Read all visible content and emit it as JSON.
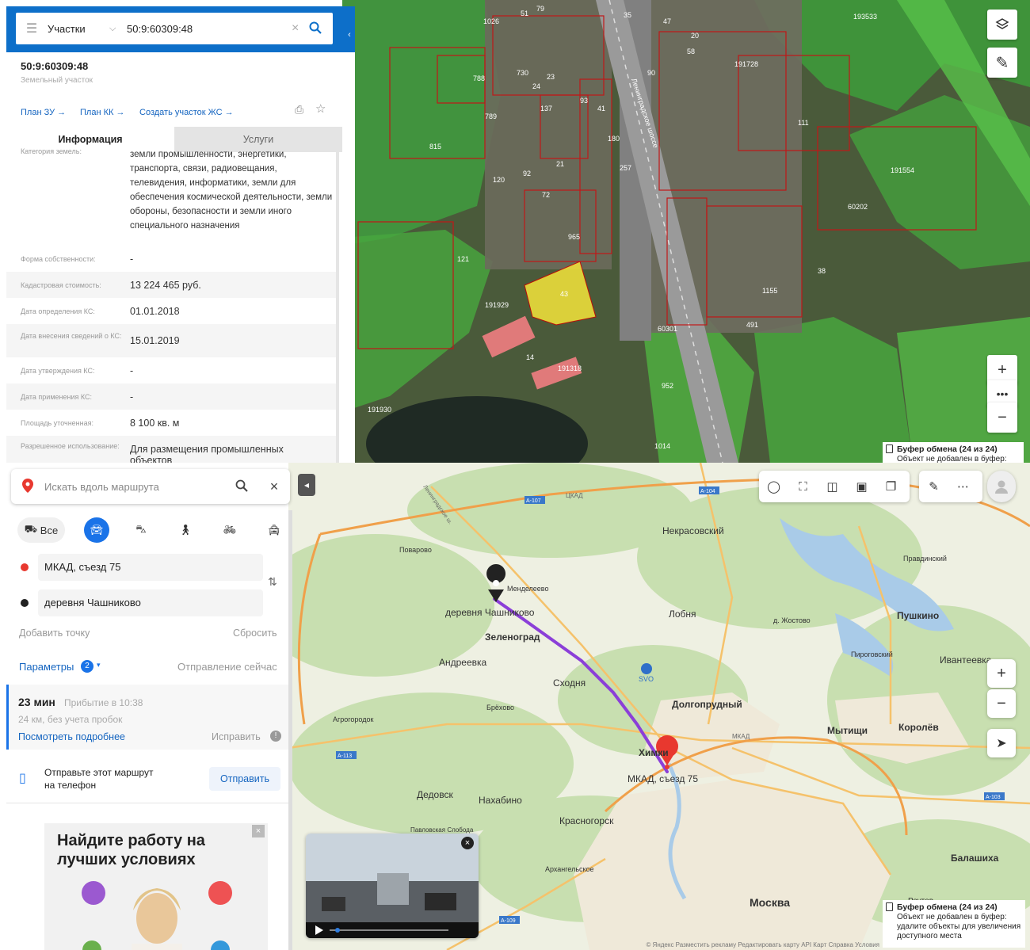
{
  "cadastral": {
    "search": {
      "category": "Участки",
      "query": "50:9:60309:48"
    },
    "parcel": {
      "number": "50:9:60309:48",
      "type": "Земельный участок"
    },
    "links": [
      "План ЗУ →",
      "План КК →",
      "Создать участок ЖС →"
    ],
    "tabs": {
      "info": "Информация",
      "services": "Услуги"
    },
    "category": {
      "label": "Категория земель:",
      "value": "земли промышленности, энергетики, транспорта, связи, радиовещания, телевидения, информатики, земли для обеспечения космической деятельности, земли обороны, безопасности и земли иного специального назначения"
    },
    "rows": [
      {
        "label": "Форма собственности:",
        "value": "-"
      },
      {
        "label": "Кадастровая стоимость:",
        "value": "13 224 465 руб."
      },
      {
        "label": "Дата определения КС:",
        "value": "01.01.2018"
      },
      {
        "label": "Дата внесения сведений о КС:",
        "value": "15.01.2019"
      },
      {
        "label": "Дата утверждения КС:",
        "value": "-"
      },
      {
        "label": "Дата применения КС:",
        "value": "-"
      },
      {
        "label": "Площадь уточненная:",
        "value": "8 100 кв. м"
      },
      {
        "label": "Разрешенное использование:",
        "value": "Для размещения промышленных объектов"
      }
    ],
    "map_labels": {
      "parcels": [
        "51",
        "79",
        "35",
        "47",
        "20",
        "58",
        "1026",
        "788",
        "730",
        "789",
        "23",
        "24",
        "93",
        "137",
        "815",
        "90",
        "180",
        "41",
        "21",
        "257",
        "92",
        "120",
        "72",
        "965",
        "121",
        "43",
        "191929",
        "191318",
        "14",
        "191930",
        "952",
        "1014",
        "191728",
        "193533",
        "111",
        "191554",
        "60202",
        "60301",
        "491",
        "1155",
        "38"
      ],
      "road": "Ленинградское шоссе"
    },
    "toast": {
      "title": "Буфер обмена (24 из 24)",
      "text": "Объект не добавлен в буфер:"
    }
  },
  "route": {
    "search_placeholder": "Искать вдоль маршрута",
    "mode_all": "Все",
    "from": "МКАД, съезд 75",
    "to": "деревня Чашниково",
    "add_point": "Добавить точку",
    "reset": "Сбросить",
    "params": "Параметры",
    "params_count": "2",
    "departure": "Отправление сейчас",
    "time": "23 мин",
    "arrival": "Прибытие в 10:38",
    "distance": "24 км, без учета пробок",
    "details": "Посмотреть подробнее",
    "fix": "Исправить",
    "send_text_1": "Отправьте этот маршрут",
    "send_text_2": "на телефон",
    "send_btn": "Отправить",
    "ad_title": "Найдите работу на лучших условиях",
    "map_places": [
      "Некрасовский",
      "Поварово",
      "Менделеево",
      "деревня Чашниково",
      "Зеленоград",
      "Андреевка",
      "Сходня",
      "Брёхово",
      "Агрогородок",
      "Лобня",
      "д. Жостово",
      "Пушкино",
      "Правдинский",
      "Пироговский",
      "Ивантеевка",
      "Долгопрудный",
      "Мытищи",
      "Королёв",
      "Химки",
      "МКАД, съезд 75",
      "Дедовск",
      "Нахабино",
      "Павловская Слобода",
      "Красногорск",
      "Архангельское",
      "Москва",
      "Балашиха",
      "Реутов",
      "SVO"
    ],
    "roads": [
      "A-107",
      "ЦКАД",
      "A-104",
      "МКАД",
      "A-113",
      "A-103",
      "A-109",
      "Ленинградское ш."
    ],
    "toast": {
      "title": "Буфер обмена (24 из 24)",
      "line1": "Объект не добавлен в буфер:",
      "line2": "удалите объекты для увеличения",
      "line3": "доступного места"
    },
    "footer": "© Яндекс  Разместить рекламу  Редактировать карту  API Карт  Справка  Условия"
  }
}
